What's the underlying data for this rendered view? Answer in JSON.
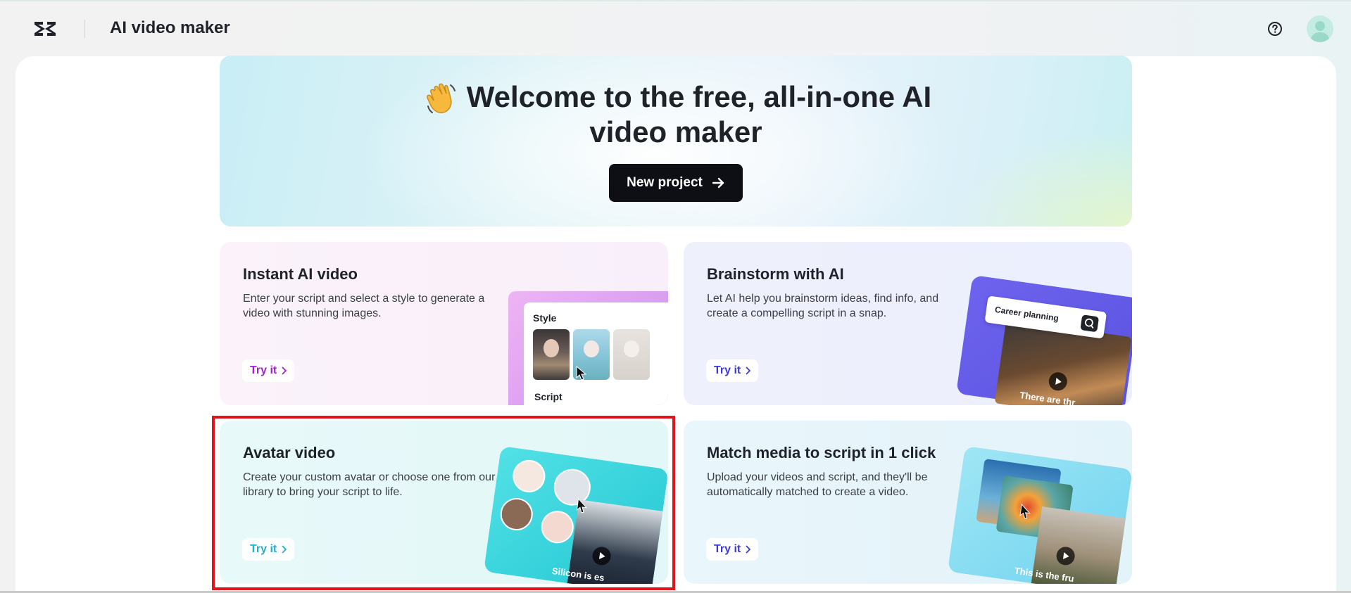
{
  "header": {
    "logo_icon": "capcut-logo-icon",
    "title": "AI video maker",
    "help_icon": "question-circle-icon",
    "avatar_icon": "user-avatar-icon"
  },
  "hero": {
    "emoji": "👋",
    "title_line1": "Welcome to the free, all-in-one AI",
    "title_line2": "video maker",
    "button_label": "New project",
    "button_icon": "arrow-right-icon"
  },
  "cards": [
    {
      "title": "Instant AI video",
      "description": "Enter your script and select a style to generate a video with stunning images.",
      "button_label": "Try it",
      "accent": "#a11fd6",
      "illustration": {
        "style_label": "Style",
        "script_label": "Script"
      }
    },
    {
      "title": "Brainstorm with AI",
      "description": "Let AI help you brainstorm ideas, find info, and create a compelling script in a snap.",
      "button_label": "Try it",
      "accent": "#3b38d6",
      "illustration": {
        "search_text": "Career planning",
        "caption": "There are thr"
      }
    },
    {
      "title": "Avatar video",
      "description": "Create your custom avatar or choose one from our library to bring your script to life.",
      "button_label": "Try it",
      "accent": "#1fb0cc",
      "illustration": {
        "caption": "Silicon is es"
      }
    },
    {
      "title": "Match media to script in 1 click",
      "description": "Upload your videos and script, and they'll be automatically matched to create a video.",
      "button_label": "Try it",
      "accent": "#3b38d6",
      "illustration": {
        "caption": "This is the fru"
      }
    }
  ],
  "highlight_color": "#e0141a"
}
